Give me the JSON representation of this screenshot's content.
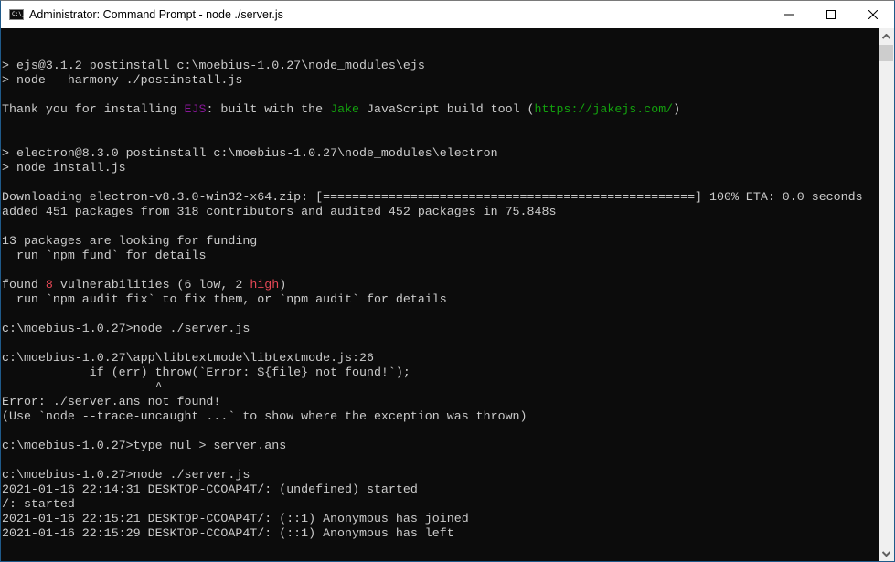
{
  "window": {
    "title": "Administrator: Command Prompt - node  ./server.js",
    "app_icon": "command-prompt-icon",
    "app_icon_text": "C:\\_",
    "controls": [
      {
        "name": "minimize-button",
        "icon": "minimize-icon"
      },
      {
        "name": "maximize-button",
        "icon": "maximize-icon"
      },
      {
        "name": "close-button",
        "icon": "close-icon"
      }
    ]
  },
  "colors": {
    "console_bg": "#0c0c0c",
    "console_fg": "#cccccc",
    "magenta": "#881798",
    "green": "#13a10e",
    "red": "#e74856"
  },
  "console": {
    "lines": [
      [
        {
          "t": "> ejs@3.1.2 postinstall c:\\moebius-1.0.27\\node_modules\\ejs"
        }
      ],
      [
        {
          "t": "> node --harmony ./postinstall.js"
        }
      ],
      [
        {
          "t": ""
        }
      ],
      [
        {
          "t": "Thank you for installing "
        },
        {
          "t": "EJS",
          "c": "magenta"
        },
        {
          "t": ": built with the "
        },
        {
          "t": "Jake",
          "c": "green"
        },
        {
          "t": " JavaScript build tool ("
        },
        {
          "t": "https://jakejs.com/",
          "c": "green"
        },
        {
          "t": ")"
        }
      ],
      [
        {
          "t": ""
        }
      ],
      [
        {
          "t": ""
        }
      ],
      [
        {
          "t": "> electron@8.3.0 postinstall c:\\moebius-1.0.27\\node_modules\\electron"
        }
      ],
      [
        {
          "t": "> node install.js"
        }
      ],
      [
        {
          "t": ""
        }
      ],
      [
        {
          "t": "Downloading electron-v8.3.0-win32-x64.zip: [===================================================] 100% ETA: 0.0 seconds"
        }
      ],
      [
        {
          "t": "added 451 packages from 318 contributors and audited 452 packages in 75.848s"
        }
      ],
      [
        {
          "t": ""
        }
      ],
      [
        {
          "t": "13 packages are looking for funding"
        }
      ],
      [
        {
          "t": "  run `npm fund` for details"
        }
      ],
      [
        {
          "t": ""
        }
      ],
      [
        {
          "t": "found "
        },
        {
          "t": "8",
          "c": "red"
        },
        {
          "t": " vulnerabilities (6 low, 2 "
        },
        {
          "t": "high",
          "c": "red"
        },
        {
          "t": ")"
        }
      ],
      [
        {
          "t": "  run `npm audit fix` to fix them, or `npm audit` for details"
        }
      ],
      [
        {
          "t": ""
        }
      ],
      [
        {
          "t": "c:\\moebius-1.0.27>node ./server.js"
        }
      ],
      [
        {
          "t": ""
        }
      ],
      [
        {
          "t": "c:\\moebius-1.0.27\\app\\libtextmode\\libtextmode.js:26"
        }
      ],
      [
        {
          "t": "            if (err) throw(`Error: ${file} not found!`);"
        }
      ],
      [
        {
          "t": "                     ^"
        }
      ],
      [
        {
          "t": "Error: ./server.ans not found!"
        }
      ],
      [
        {
          "t": "(Use `node --trace-uncaught ...` to show where the exception was thrown)"
        }
      ],
      [
        {
          "t": ""
        }
      ],
      [
        {
          "t": "c:\\moebius-1.0.27>type nul > server.ans"
        }
      ],
      [
        {
          "t": ""
        }
      ],
      [
        {
          "t": "c:\\moebius-1.0.27>node ./server.js"
        }
      ],
      [
        {
          "t": "2021-01-16 22:14:31 DESKTOP-CCOAP4T/: (undefined) started"
        }
      ],
      [
        {
          "t": "/: started"
        }
      ],
      [
        {
          "t": "2021-01-16 22:15:21 DESKTOP-CCOAP4T/: (::1) Anonymous has joined"
        }
      ],
      [
        {
          "t": "2021-01-16 22:15:29 DESKTOP-CCOAP4T/: (::1) Anonymous has left"
        }
      ]
    ]
  },
  "scrollbar": {
    "up_icon": "scroll-up-arrow-icon",
    "down_icon": "scroll-down-arrow-icon"
  }
}
